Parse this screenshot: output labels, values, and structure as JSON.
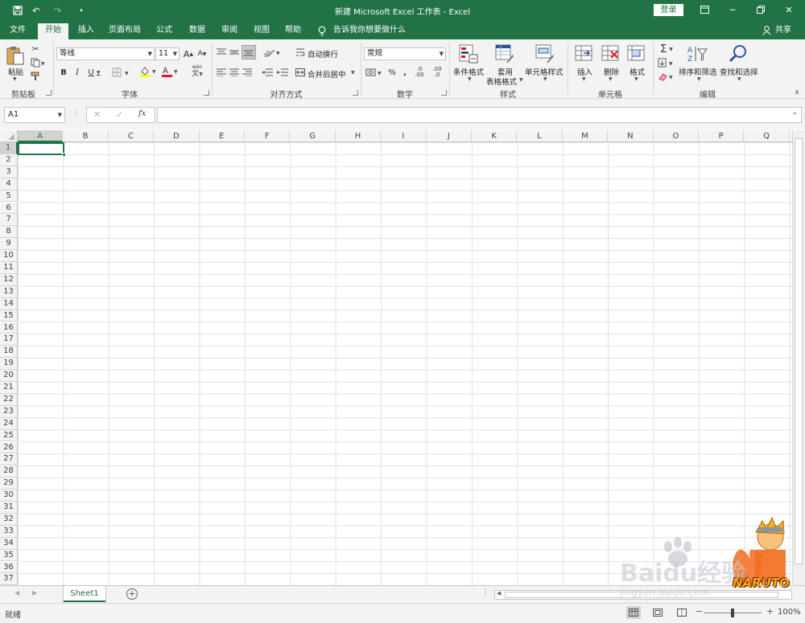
{
  "window": {
    "title": "新建 Microsoft Excel 工作表  -  Excel",
    "login": "登录"
  },
  "tabs": [
    {
      "label": "文件"
    },
    {
      "label": "开始"
    },
    {
      "label": "插入"
    },
    {
      "label": "页面布局"
    },
    {
      "label": "公式"
    },
    {
      "label": "数据"
    },
    {
      "label": "审阅"
    },
    {
      "label": "视图"
    },
    {
      "label": "帮助"
    }
  ],
  "tell_me": "告诉我你想要做什么",
  "share": "共享",
  "ribbon": {
    "clipboard": {
      "paste": "粘贴",
      "label": "剪贴板"
    },
    "font": {
      "name": "等线",
      "size": "11",
      "phonetic": "wén",
      "label": "字体"
    },
    "alignment": {
      "wrap": "自动换行",
      "merge": "合并后居中",
      "label": "对齐方式"
    },
    "number": {
      "format": "常规",
      "label": "数字"
    },
    "styles": {
      "conditional": "条件格式",
      "table_line1": "套用",
      "table_line2": "表格格式",
      "cell_styles": "单元格样式",
      "label": "样式"
    },
    "cells": {
      "insert": "插入",
      "delete": "删除",
      "format": "格式",
      "label": "单元格"
    },
    "editing": {
      "sort": "排序和筛选",
      "find": "查找和选择",
      "label": "编辑"
    },
    "colors": {
      "accent": "#217346",
      "font_color": "#e81123",
      "highlight": "#ffff00"
    }
  },
  "formula_bar": {
    "name_box": "A1",
    "fx": "fx",
    "value": ""
  },
  "grid": {
    "columns": [
      "A",
      "B",
      "C",
      "D",
      "E",
      "F",
      "G",
      "H",
      "I",
      "J",
      "K",
      "L",
      "M",
      "N",
      "O",
      "P",
      "Q"
    ],
    "rows": [
      "1",
      "2",
      "3",
      "4",
      "5",
      "6",
      "7",
      "8",
      "9",
      "10",
      "11",
      "12",
      "13",
      "14",
      "15",
      "16",
      "17",
      "18",
      "19",
      "20",
      "21",
      "22",
      "23",
      "24",
      "25",
      "26",
      "27",
      "28",
      "29",
      "30",
      "31",
      "32",
      "33",
      "34",
      "35",
      "36",
      "37"
    ],
    "active_cell": "A1"
  },
  "sheets": [
    {
      "label": "Sheet1"
    }
  ],
  "status": {
    "ready": "就绪",
    "zoom": "100%"
  },
  "watermark": {
    "brand": "Baidu经验",
    "url": "jingyan.baidu.com",
    "logo": "NARUTO"
  }
}
